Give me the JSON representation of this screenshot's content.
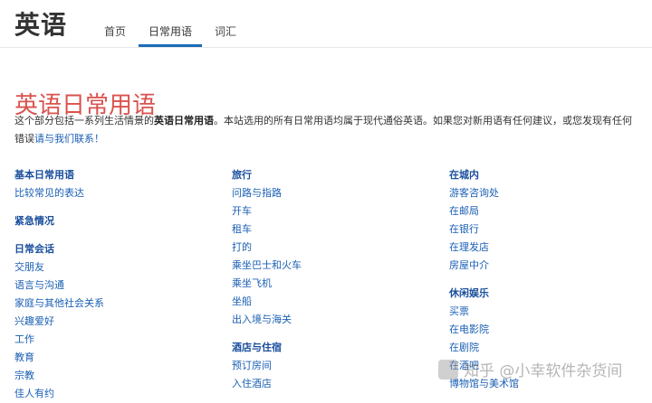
{
  "header": {
    "logo": "英语",
    "tabs": [
      {
        "label": "首页"
      },
      {
        "label": "日常用语"
      },
      {
        "label": "词汇"
      }
    ]
  },
  "main": {
    "title": "英语日常用语",
    "intro": {
      "before": "这个部分包括一系列生活情景的",
      "bold": "英语日常用语",
      "after": "。本站选用的所有日常用语均属于现代通俗英语。如果您对新用语有任何建议，或您发现有任何错误",
      "link": "请与我们联系！"
    }
  },
  "columns": [
    {
      "groups": [
        {
          "title": "基本日常用语",
          "items": [
            "比较常见的表达"
          ]
        },
        {
          "title": "紧急情况",
          "items": []
        },
        {
          "title": "日常会话",
          "items": [
            "交朋友",
            "语言与沟通",
            "家庭与其他社会关系",
            "兴趣爱好",
            "工作",
            "教育",
            "宗教",
            "佳人有约"
          ]
        }
      ]
    },
    {
      "groups": [
        {
          "title": "旅行",
          "items": [
            "问路与指路",
            "开车",
            "租车",
            "打的",
            "乘坐巴士和火车",
            "乘坐飞机",
            "坐船",
            "出入境与海关"
          ]
        },
        {
          "title": "酒店与住宿",
          "items": [
            "预订房间",
            "入住酒店"
          ]
        }
      ]
    },
    {
      "groups": [
        {
          "title": "在城内",
          "items": [
            "游客咨询处",
            "在邮局",
            "在银行",
            "在理发店",
            "房屋中介"
          ]
        },
        {
          "title": "休闲娱乐",
          "items": [
            "买票",
            "在电影院",
            "在剧院",
            "在酒吧",
            "博物馆与美术馆"
          ]
        }
      ]
    }
  ],
  "watermark": "知乎 @小幸软件杂货间"
}
